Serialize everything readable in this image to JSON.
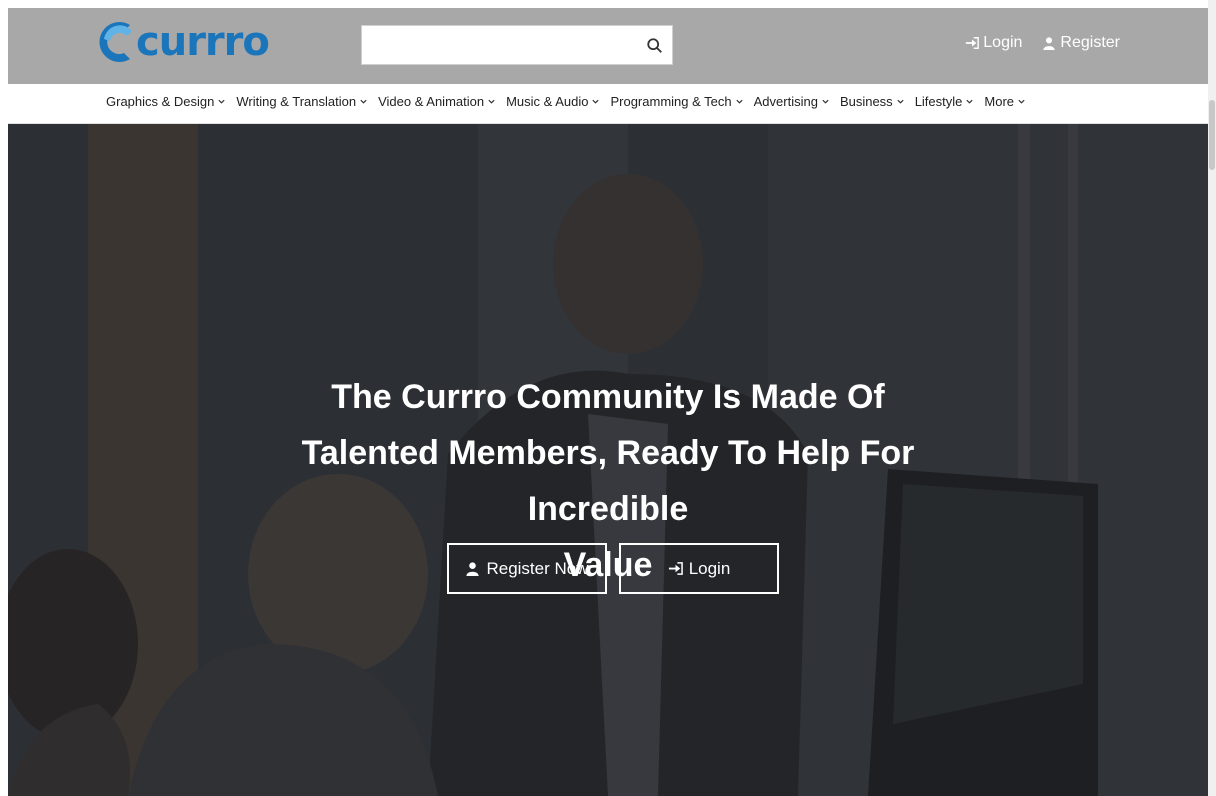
{
  "brand": {
    "name": "currro",
    "color": "#1b75bb"
  },
  "search": {
    "placeholder": "",
    "icon": "search-icon"
  },
  "auth": {
    "login_label": "Login",
    "register_label": "Register"
  },
  "categories": [
    {
      "label": "Graphics & Design"
    },
    {
      "label": "Writing & Translation"
    },
    {
      "label": "Video & Animation"
    },
    {
      "label": "Music & Audio"
    },
    {
      "label": "Programming & Tech"
    },
    {
      "label": "Advertising"
    },
    {
      "label": "Business"
    },
    {
      "label": "Lifestyle"
    },
    {
      "label": "More"
    }
  ],
  "hero": {
    "title_line1": "The Currro Community Is Made Of",
    "title_line2": "Talented Members, Ready To Help For Incredible",
    "title_line3": "Value",
    "register_button": "Register Now",
    "login_button": "Login"
  },
  "colors": {
    "topbar": "#a8a8a8",
    "hero_overlay": "#2e3036"
  }
}
